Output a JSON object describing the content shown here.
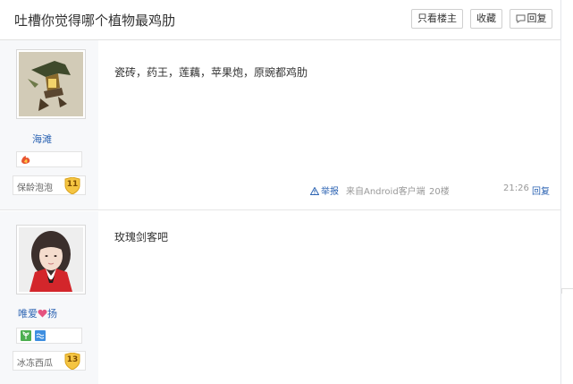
{
  "header": {
    "title": "吐槽你觉得哪个植物最鸡肋",
    "only_op_label": "只看楼主",
    "favorite_label": "收藏",
    "reply_label": "回复"
  },
  "posts": [
    {
      "username": "海滩",
      "level_name": "保龄泡泡",
      "level": "11",
      "content": "瓷砖，药王，莲藕，苹果炮，原豌都鸡肋",
      "report_label": "举报",
      "source": "来自Android客户端",
      "floor": "20楼",
      "time": "21:26",
      "reply_label": "回复"
    },
    {
      "username": "唯爱",
      "username_suffix": "扬",
      "level_name": "冰冻西瓜",
      "level": "13",
      "content": "玫瑰剑客吧"
    }
  ],
  "icons": [
    "reply-bubble-icon",
    "warning-icon",
    "heart-icon"
  ],
  "colors": {
    "link": "#2d64b3",
    "badge_gold": "#f5c542"
  }
}
